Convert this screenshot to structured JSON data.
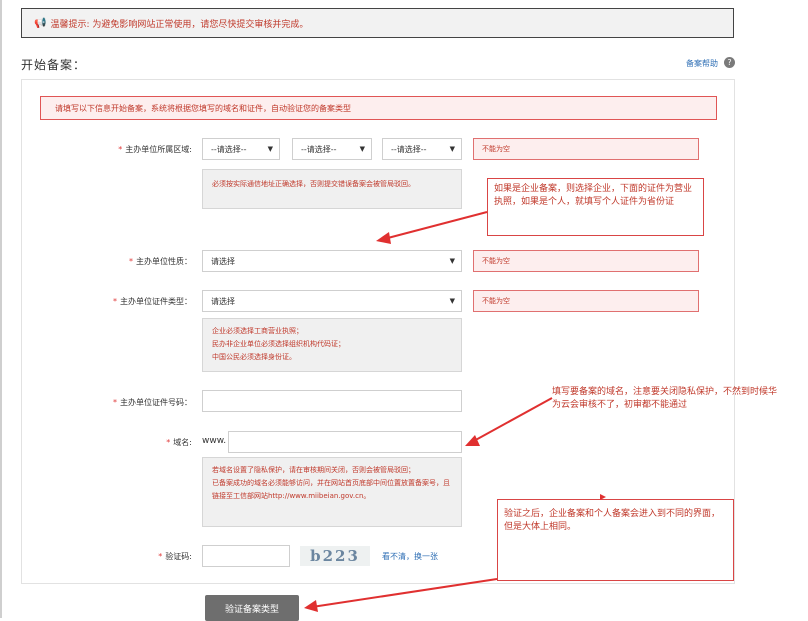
{
  "notice": {
    "icon": "speaker-icon",
    "text": "温馨提示: 为避免影响网站正常使用，请您尽快提交审核并完成。"
  },
  "page": {
    "title": "开始备案：",
    "help_link": "备案帮助",
    "help_icon": "?"
  },
  "alert": "请填写以下信息开始备案，系统将根据您填写的域名和证件，自动验证您的备案类型",
  "region": {
    "label": "主办单位所属区域:",
    "select1": "--请选择--",
    "select2": "--请选择--",
    "select3": "--请选择--",
    "error": "不能为空",
    "hint": "必须按实际通信地址正确选择，否则提交错误备案会被管局驳回。"
  },
  "nature": {
    "label": "主办单位性质：",
    "select": "请选择",
    "error": "不能为空"
  },
  "cert_type": {
    "label": "主办单位证件类型：",
    "select": "请选择",
    "error": "不能为空",
    "hint_lines": [
      "企业必须选择工商营业执照；",
      "民办非企业单位必须选择组织机构代码证；",
      "中国公民必须选择身份证。"
    ]
  },
  "cert_no": {
    "label": "主办单位证件号码："
  },
  "domain": {
    "label": "域名:",
    "prefix": "www.",
    "hint_lines": [
      "若域名设置了隐私保护，请在审核期间关闭，否则会被管局驳回；",
      "已备案成功的域名必须能够访问，并在网站首页底部中间位置放置备案号，且链接至工信部网站http://www.miibeian.gov.cn。"
    ]
  },
  "captcha": {
    "label": "验证码:",
    "image_text": "b223",
    "refresh_link": "看不清，换一张"
  },
  "submit_label": "验证备案类型",
  "annotations": {
    "note1": "如果是企业备案，则选择企业，下面的证件为营业执照，如果是个人，就填写个人证件为省份证",
    "note2": "填写要备案的域名，注意要关闭隐私保护，不然到时候华为云会审核不了，初审都不能通过",
    "note3": "验证之后，企业备案和个人备案会进入到不同的界面，但是大体上相同。"
  },
  "colors": {
    "error_red": "#c0392b",
    "link_blue": "#2f6fb5",
    "button_gray": "#6e6e6e"
  }
}
